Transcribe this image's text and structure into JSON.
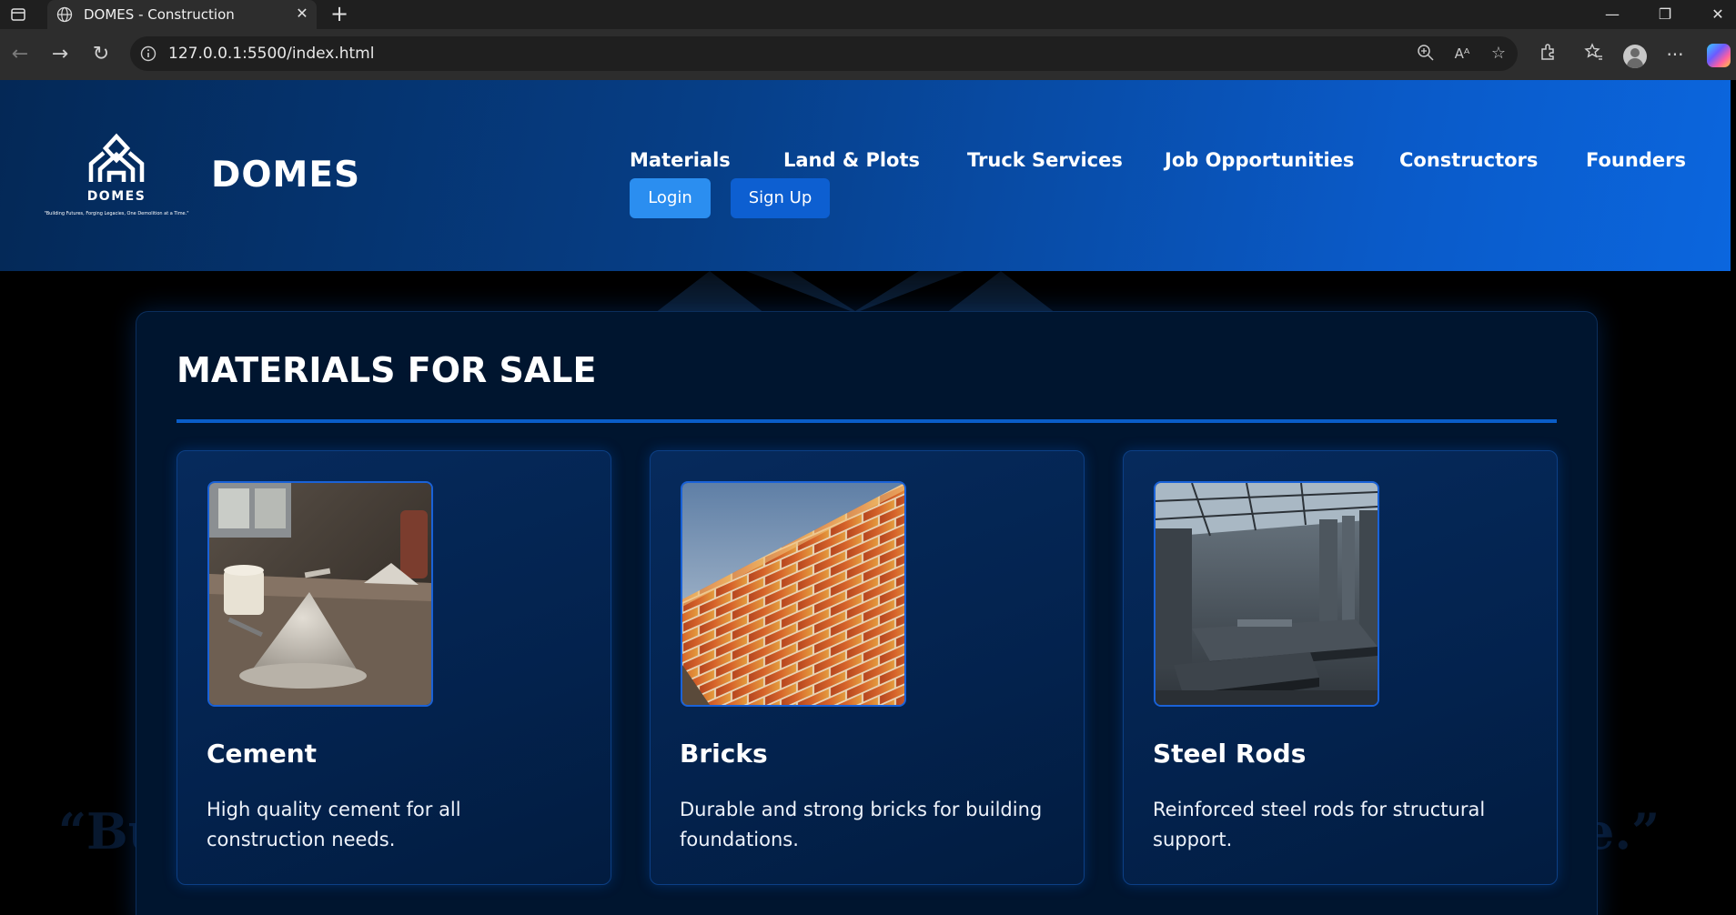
{
  "browser": {
    "tab_title": "DOMES - Construction",
    "url": "127.0.0.1:5500/index.html"
  },
  "header": {
    "brand": "DOMES",
    "logo_text": "DOMES",
    "logo_tagline": "\"Building Futures, Forging Legacies, One Demolition at a Time.\"",
    "nav": [
      "Materials",
      "Land & Plots",
      "Truck Services",
      "Job Opportunities",
      "Constructors",
      "Founders"
    ],
    "login_label": "Login",
    "signup_label": "Sign Up"
  },
  "main": {
    "section_title": "MATERIALS FOR SALE",
    "background_quote_left": "“Bu",
    "background_quote_right": "e.”",
    "cards": [
      {
        "title": "Cement",
        "description": "High quality cement for all construction needs.",
        "image": "cement-pile-photo"
      },
      {
        "title": "Bricks",
        "description": "Durable and strong bricks for building foundations.",
        "image": "brick-wall-photo"
      },
      {
        "title": "Steel Rods",
        "description": "Reinforced steel rods for structural support.",
        "image": "steel-factory-photo"
      }
    ]
  },
  "colors": {
    "header_gradient_start": "#042856",
    "header_gradient_end": "#0b66de",
    "login_button": "#2b8ef0",
    "signup_button": "#0d5fd1",
    "panel_bg": "#00152f",
    "accent_rule": "#0a5dc8"
  }
}
